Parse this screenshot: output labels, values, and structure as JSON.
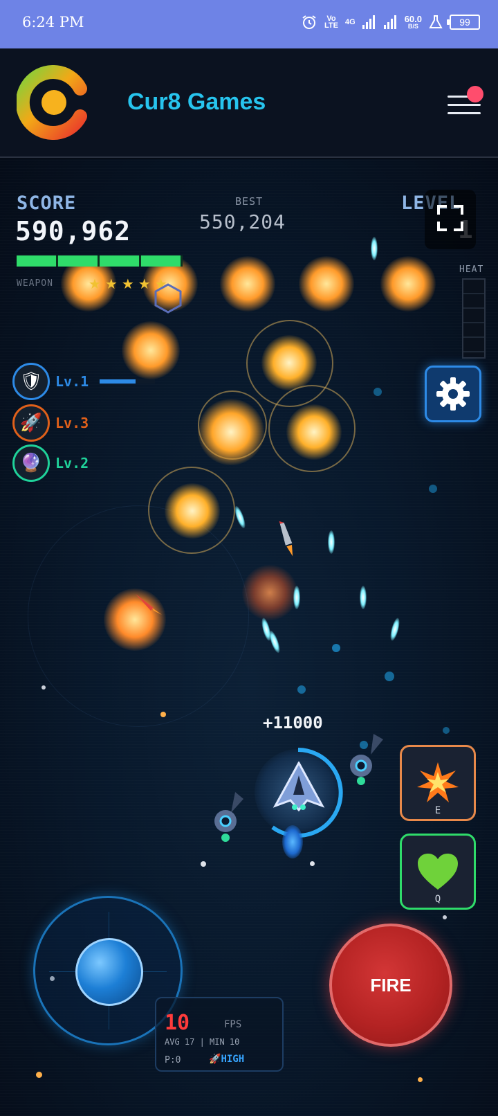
{
  "status_bar": {
    "time": "6:24 PM",
    "volte": "Vo LTE",
    "network": "4G",
    "speed": "60.0",
    "speed_unit": "B/S",
    "battery": "99"
  },
  "app_bar": {
    "title": "Cur8 Games",
    "logo_icon": "cur8-logo-icon",
    "menu_icon": "hamburger-menu-icon",
    "notification_dot_color": "#ff4d6d"
  },
  "hud": {
    "score_label": "SCORE",
    "score_value": "590,962",
    "best_label": "BEST",
    "best_value": "550,204",
    "level_label": "LEVEL",
    "level_value": "1",
    "heat_label": "HEAT",
    "weapon_label": "WEAPON",
    "weapon_stars": "★★★★★",
    "weapon_progress": 1.0
  },
  "powerups": [
    {
      "icon": "shield-icon",
      "label": "Lv.1",
      "color": "#2d8ae6",
      "progress": 0.65
    },
    {
      "icon": "rocket-icon",
      "label": "Lv.3",
      "color": "#e0601a"
    },
    {
      "icon": "orb-icon",
      "label": "Lv.2",
      "color": "#1fd29a"
    }
  ],
  "combo_text": "+11000",
  "abilities": [
    {
      "name": "explosion",
      "icon": "explosion-icon",
      "key": "E",
      "color": "#e8894a"
    },
    {
      "name": "heal",
      "icon": "green-heart-icon",
      "key": "Q",
      "color": "#2fdc6a"
    }
  ],
  "controls": {
    "fire_label": "FIRE",
    "joystick_icon": "joystick-icon"
  },
  "fps_panel": {
    "fps_value": "10",
    "fps_label": "FPS",
    "avg_text": "AVG 17 | MIN 10",
    "p_text": "P:0",
    "quality": "HIGH"
  },
  "colors": {
    "accent": "#27c4ee",
    "progress": "#2fdc6a",
    "fire": "#b42323"
  }
}
